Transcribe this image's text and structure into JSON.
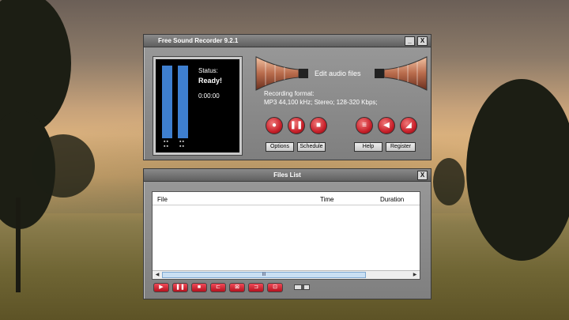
{
  "recorder": {
    "title": "Free Sound Recorder 9.2.1",
    "status_label": "Status:",
    "status_value": "Ready!",
    "time": "0:00:00",
    "edit_label": "Edit audio files",
    "format_label": "Recording format:",
    "format_value": "MP3 44,100 kHz; Stereo;  128-320 Kbps;",
    "buttons": {
      "options": "Options",
      "schedule": "Schedule",
      "help": "Help",
      "register": "Register"
    },
    "minimize_glyph": "_",
    "close_glyph": "X"
  },
  "files_list": {
    "title": "Files List",
    "close_glyph": "X",
    "columns": [
      "File",
      "Time",
      "Duration"
    ],
    "scroll_thumb": "III",
    "scroll_left": "◀",
    "scroll_right": "▶"
  },
  "icons": {
    "record": "record-icon",
    "pause": "pause-icon",
    "stop": "stop-icon",
    "list": "list-icon",
    "back": "back-icon",
    "edit": "edit-icon"
  },
  "colors": {
    "meter": "#3e7fcf",
    "button_red": "#c8202a",
    "panel_gray": "#8a8a8a"
  }
}
